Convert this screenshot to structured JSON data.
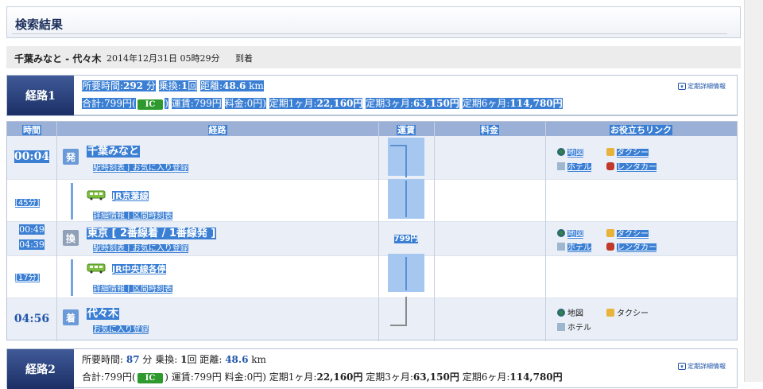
{
  "header": {
    "title": "検索結果"
  },
  "condition": {
    "route": "千葉みなと - 代々木",
    "datetime": "2014年12月31日 05時29分",
    "arrival": "到着"
  },
  "routes": [
    {
      "badge": "経路1",
      "time_label": "所要時間:",
      "time_value": "292",
      "time_unit": "分",
      "transfer_label": "乗換:",
      "transfer_value": "1",
      "transfer_unit": "回",
      "distance_label": "距離:",
      "distance_value": "48.6",
      "distance_unit": "km",
      "total_label": "合計:",
      "total_value": "799円(",
      "ic": "IC",
      "total_close": ")",
      "fare_label": "運賃:",
      "fare_value": "799円",
      "charge_label": "料金:",
      "charge_value": "0円)",
      "teiki1_label": "定期1ヶ月:",
      "teiki1_value": "22,160円",
      "teiki3_label": "定期3ヶ月:",
      "teiki3_value": "63,150円",
      "teiki6_label": "定期6ヶ月:",
      "teiki6_value": "114,780円",
      "teiki_link": "定期詳細情報"
    },
    {
      "badge": "経路2",
      "time_label": "所要時間:",
      "time_value": "87",
      "time_unit": "分",
      "transfer_label": "乗換:",
      "transfer_value": "1",
      "transfer_unit": "回",
      "distance_label": "距離:",
      "distance_value": "48.6",
      "distance_unit": "km",
      "total_label": "合計:",
      "total_value": "799円(",
      "ic": "IC",
      "total_close": ")",
      "fare_label": "運賃:",
      "fare_value": "799円",
      "charge_label": "料金:",
      "charge_value": "0円)",
      "teiki1_label": "定期1ヶ月:",
      "teiki1_value": "22,160円",
      "teiki3_label": "定期3ヶ月:",
      "teiki3_value": "63,150円",
      "teiki6_label": "定期6ヶ月:",
      "teiki6_value": "114,780円",
      "teiki_link": "定期詳細情報"
    }
  ],
  "table": {
    "headers": {
      "time": "時間",
      "route": "経路",
      "fare": "運賃",
      "charge": "料金",
      "tools": "お役立ちリンク"
    },
    "start": {
      "time": "00:04",
      "badge": "発",
      "name": "千葉みなと",
      "links": "駅時刻表 | お気に入り登録"
    },
    "leg1": {
      "duration": "[45分]",
      "line": "JR京葉線",
      "links": "詳細情報 | 区間時刻表"
    },
    "transfer": {
      "arr_time": "00:49",
      "dep_time": "04:39",
      "badge": "換",
      "name": "東京 [ 2番線着 / 1番線発 ]",
      "links": "駅時刻表 | お気に入り登録",
      "fare": "799円"
    },
    "leg2": {
      "duration": "[17分]",
      "line": "JR中央線各停",
      "links": "詳細情報 | 区間時刻表"
    },
    "end": {
      "time": "04:56",
      "badge": "着",
      "name": "代々木",
      "links": "お気に入り登録"
    },
    "tools": {
      "map": "地図",
      "taxi": "タクシー",
      "hotel": "ホテル",
      "rental": "レンタカー"
    }
  },
  "colors": {
    "accent": "#3b7fd4",
    "header_navy": "#1c2f66",
    "ic_green": "#2e9a2e"
  }
}
